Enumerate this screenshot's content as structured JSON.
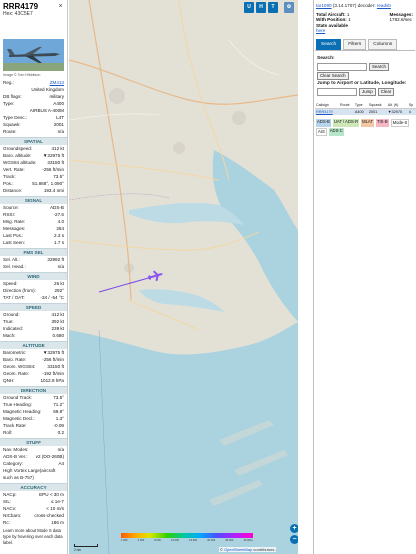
{
  "aircraft": {
    "callsign": "RRR4179",
    "hex_label": "Hex:",
    "hex": "43C5E7",
    "photo_credit": "Image © Tom Hibbitson"
  },
  "close_symbol": "×",
  "info_rows": [
    {
      "k": "Reg.:",
      "v": "ZM413",
      "link": true
    },
    {
      "k": "",
      "v": "United Kingdom"
    },
    {
      "k": "DB flags:",
      "v": "military"
    },
    {
      "k": "Type:",
      "v": "A400"
    },
    {
      "k": "",
      "v": "AIRBUS A-400M"
    },
    {
      "k": "Type Desc.:",
      "v": "L4T"
    },
    {
      "k": "Squawk:",
      "v": "2001"
    },
    {
      "k": "Route:",
      "v": "n/a"
    }
  ],
  "sections": [
    {
      "title": "SPATIAL",
      "rows": [
        {
          "k": "Groundspeed:",
          "v": "412 kt"
        },
        {
          "k": "Baro. altitude:",
          "v": "▼32975 ft"
        },
        {
          "k": "WGS84 altitude:",
          "v": "33150 ft"
        },
        {
          "k": "Vert. Rate:",
          "v": "-256 ft/min"
        },
        {
          "k": "Track:",
          "v": "73.5°"
        },
        {
          "k": "Pos.:",
          "v": "51.868°, 1.090°"
        },
        {
          "k": "Distance:",
          "v": "193.4 nmi"
        }
      ]
    },
    {
      "title": "SIGNAL",
      "rows": [
        {
          "k": "Source:",
          "v": "ADS-B"
        },
        {
          "k": "RSSI:",
          "v": "-27.6"
        },
        {
          "k": "Msg. Rate:",
          "v": "4.0"
        },
        {
          "k": "Messages:",
          "v": "264"
        },
        {
          "k": "Last Pos.:",
          "v": "2.3 s"
        },
        {
          "k": "Last Seen:",
          "v": "1.7 s"
        }
      ]
    },
    {
      "title": "FMS SEL",
      "rows": [
        {
          "k": "Sel. Alt.:",
          "v": "32992 ft"
        },
        {
          "k": "Sel. Head.:",
          "v": "n/a"
        }
      ]
    },
    {
      "title": "WIND",
      "rows": [
        {
          "k": "Speed:",
          "v": "26 kt"
        },
        {
          "k": "Direction (from):",
          "v": "292°"
        },
        {
          "k": "TAT / OAT:",
          "v": "-34 / -54 °C"
        }
      ]
    },
    {
      "title": "SPEED",
      "rows": [
        {
          "k": "Ground:",
          "v": "412 kt"
        },
        {
          "k": "True:",
          "v": "392 kt"
        },
        {
          "k": "Indicated:",
          "v": "239 kt"
        },
        {
          "k": "Mach:",
          "v": "0.680"
        }
      ]
    },
    {
      "title": "ALTITUDE",
      "rows": [
        {
          "k": "Barometric:",
          "v": "▼32975 ft"
        },
        {
          "k": "Baro. Rate:",
          "v": "-256 ft/min"
        },
        {
          "k": "Geom. WGS84:",
          "v": "33150 ft"
        },
        {
          "k": "Geom. Rate:",
          "v": "-192 ft/min"
        },
        {
          "k": "QNH:",
          "v": "1012.8 hPa"
        }
      ]
    },
    {
      "title": "DIRECTION",
      "rows": [
        {
          "k": "Ground Track:",
          "v": "73.5°"
        },
        {
          "k": "True Heading:",
          "v": "71.2°"
        },
        {
          "k": "Magnetic Heading:",
          "v": "69.8°"
        },
        {
          "k": "Magnetic Decl.:",
          "v": "1.3°"
        },
        {
          "k": "Track Rate:",
          "v": "-0.09"
        },
        {
          "k": "Roll:",
          "v": "0.2"
        }
      ]
    },
    {
      "title": "STUFF",
      "rows": [
        {
          "k": "Nav. Modes:",
          "v": "n/a"
        },
        {
          "k": "ADS-B Ver.:",
          "v": "v2 (DO-260B)"
        },
        {
          "k": "Category:",
          "v": "A4"
        },
        {
          "k": "High Vortex Large(aircraft such as B-757)",
          "v": ""
        }
      ]
    },
    {
      "title": "ACCURACY",
      "rows": [
        {
          "k": "NACp:",
          "v": "EPU < 30 m"
        },
        {
          "k": "SIL:",
          "v": "≤ 1e-7"
        },
        {
          "k": "NACv:",
          "v": "< 10 m/s"
        },
        {
          "k": "NICbaro:",
          "v": "cross-checked"
        },
        {
          "k": "Rc:",
          "v": "186 m"
        }
      ]
    }
  ],
  "footer_note": "Learn more about Mode S data type by hovering over each data label.",
  "map": {
    "buttons_top": [
      "U",
      "H",
      "T"
    ],
    "buttons_side": [
      "I",
      "O",
      "K",
      "M",
      "P",
      "R",
      "T"
    ],
    "zoom_in": "+",
    "zoom_out": "−",
    "scale_label": "2 nm",
    "altitude_ticks": [
      "1 000",
      "4 000",
      "8 000",
      "12 000",
      "16 000",
      "20 000",
      "30 000",
      "40 000+"
    ],
    "attribution_prefix": "© ",
    "attribution_link": "OpenStreetMap",
    "attribution_suffix": " contributors.",
    "colors": {
      "land": "#e3e1d6",
      "sea": "#aad3df",
      "track": "#7a47e8",
      "aircraft": "#8a55f0"
    }
  },
  "right": {
    "version_link": "tar1090",
    "version": "(3.14.1707)",
    "decoder_label": "decoder:",
    "decoder_link": "readsb",
    "total_label": "Total Aircraft:",
    "total": "1",
    "messages_label": "Messages:",
    "messages": "1782.8/sec",
    "withpos_label": "With Position:",
    "withpos": "1",
    "stats_label": "Stats available",
    "stats_link": "here",
    "tabs": [
      "Search",
      "Filters",
      "Columns"
    ],
    "search_label": "Search:",
    "search_button": "Search",
    "clear_search_button": "Clear Search",
    "jump_label": "Jump to Airport or Latitude, Longitude:",
    "jump_button": "Jump",
    "clear_button": "Clear",
    "table_headers": [
      "Callsign",
      "Route",
      "Type",
      "Squawk",
      "Alt. (ft)",
      "Sp"
    ],
    "table_rows": [
      {
        "callsign": "RRR4179",
        "route": "",
        "type": "A400",
        "squawk": "2001",
        "alt": "▼32975",
        "sp": "4"
      }
    ],
    "legend": [
      {
        "label": "ADS-B",
        "color": "#b8d3ec"
      },
      {
        "label": "UAT / ADS-R",
        "color": "#cde7b8"
      },
      {
        "label": "MLAT",
        "color": "#f4c7a4"
      },
      {
        "label": "TIS-B",
        "color": "#f6b6c6"
      },
      {
        "label": "Mode-S",
        "color": "#ffffff"
      },
      {
        "label": "AIS",
        "color": "#ffffff"
      },
      {
        "label": "ADS-C",
        "color": "#b7e6c9"
      }
    ]
  }
}
